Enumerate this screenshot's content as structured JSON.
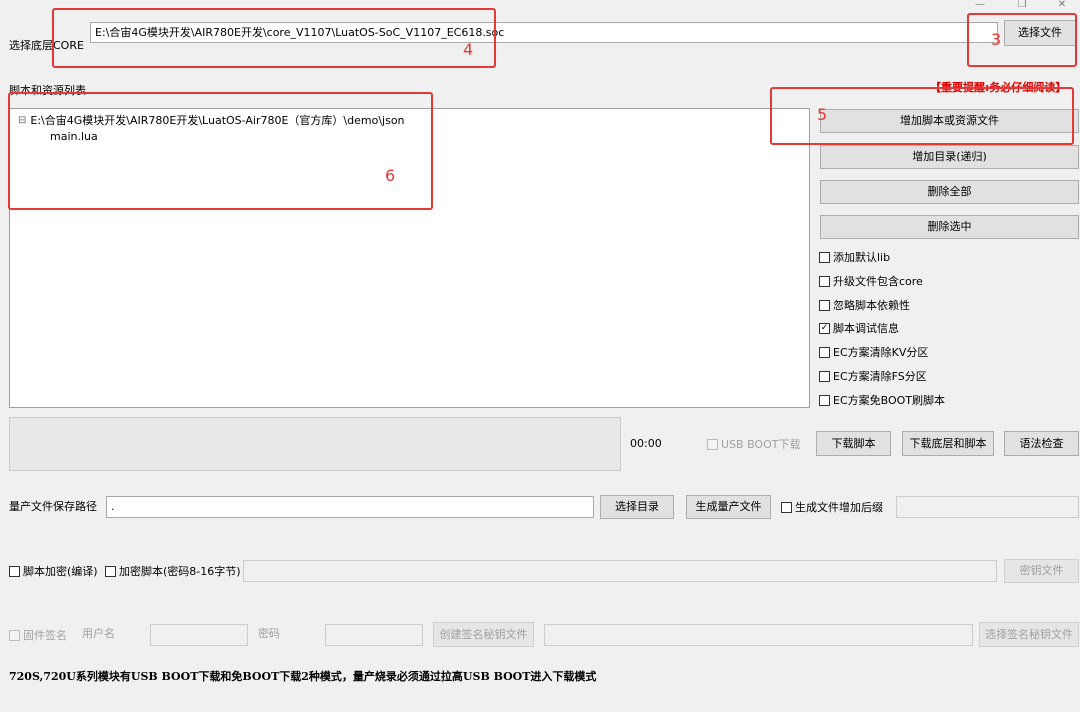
{
  "window": {
    "min_glyph": "—",
    "restore_glyph": "❐",
    "close_glyph": "✕"
  },
  "core": {
    "label": "选择底层CORE",
    "path": "E:\\合宙4G模块开发\\AIR780E开发\\core_V1107\\LuatOS-SoC_V1107_EC618.soc",
    "select_file_btn": "选择文件"
  },
  "scripts": {
    "section_label": "脚本和资源列表",
    "notice": "【重要提醒:务必仔细阅读】",
    "tree_root": "E:\\合宙4G模块开发\\AIR780E开发\\LuatOS-Air780E（官方库）\\demo\\json",
    "tree_expander": "⊟",
    "tree_child": "main.lua",
    "buttons": {
      "add_files": "增加脚本或资源文件",
      "add_dir": "增加目录(递归)",
      "delete_all": "删除全部",
      "delete_selected": "删除选中"
    },
    "options": [
      {
        "label": "添加默认lib",
        "checked": false
      },
      {
        "label": "升级文件包含core",
        "checked": false
      },
      {
        "label": "忽略脚本依赖性",
        "checked": false
      },
      {
        "label": "脚本调试信息",
        "checked": true
      },
      {
        "label": "EC方案清除KV分区",
        "checked": false
      },
      {
        "label": "EC方案清除FS分区",
        "checked": false
      },
      {
        "label": "EC方案免BOOT刷脚本",
        "checked": false
      }
    ]
  },
  "download": {
    "timer": "00:00",
    "usb_boot_label": "USB BOOT下载",
    "download_script_btn": "下载脚本",
    "download_core_script_btn": "下载底层和脚本",
    "syntax_check_btn": "语法检查"
  },
  "production": {
    "path_label": "量产文件保存路径",
    "path_value": ".",
    "select_dir_btn": "选择目录",
    "generate_btn": "生成量产文件",
    "suffix_label": "生成文件增加后缀"
  },
  "encryption": {
    "compile_label": "脚本加密(编译)",
    "encrypt_label": "加密脚本(密码8-16字节)",
    "key_file_btn": "密钥文件"
  },
  "signature": {
    "firmware_sign_label": "固件签名",
    "username_label": "用户名",
    "password_label": "密码",
    "create_key_btn": "创建签名秘钥文件",
    "select_key_btn": "选择签名秘钥文件"
  },
  "footer_note": "720S,720U系列模块有USB BOOT下载和免BOOT下载2种模式，量产烧录必须通过拉高USB BOOT进入下载模式",
  "annotations": {
    "n3": "3",
    "n4": "4",
    "n5": "5",
    "n6": "6"
  },
  "colors": {
    "annotation_red": "#e53935",
    "notice_red": "#e00000"
  }
}
